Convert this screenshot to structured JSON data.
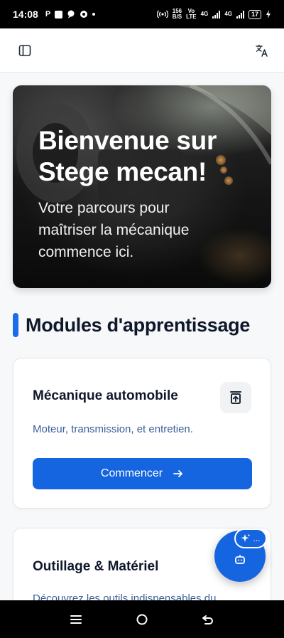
{
  "status_bar": {
    "time": "14:08",
    "app_letter": "P",
    "net_speed_top": "156",
    "net_speed_bottom": "B/S",
    "volte_top": "Vo",
    "volte_bottom": "LTE",
    "net1": "4G",
    "net2": "4G",
    "battery": "17"
  },
  "header": {
    "sidebar_icon": "sidebar-toggle-icon",
    "translate_icon": "translate-icon"
  },
  "hero": {
    "title": "Bienvenue sur Stege mecan!",
    "subtitle": "Votre parcours pour maîtriser la mécanique commence ici."
  },
  "section": {
    "title": "Modules d'apprentissage"
  },
  "modules": [
    {
      "title": "Mécanique automobile",
      "description": "Moteur, transmission, et entretien.",
      "button_label": "Commencer",
      "icon": "car-jack-icon"
    },
    {
      "title": "Outillage & Matériel",
      "description": "Découvrez les outils indispensables du"
    }
  ],
  "fab": {
    "pill_text": "..."
  },
  "colors": {
    "accent": "#1565e0",
    "section_bar": "#1a6ce8",
    "description": "#3b5f9a"
  }
}
